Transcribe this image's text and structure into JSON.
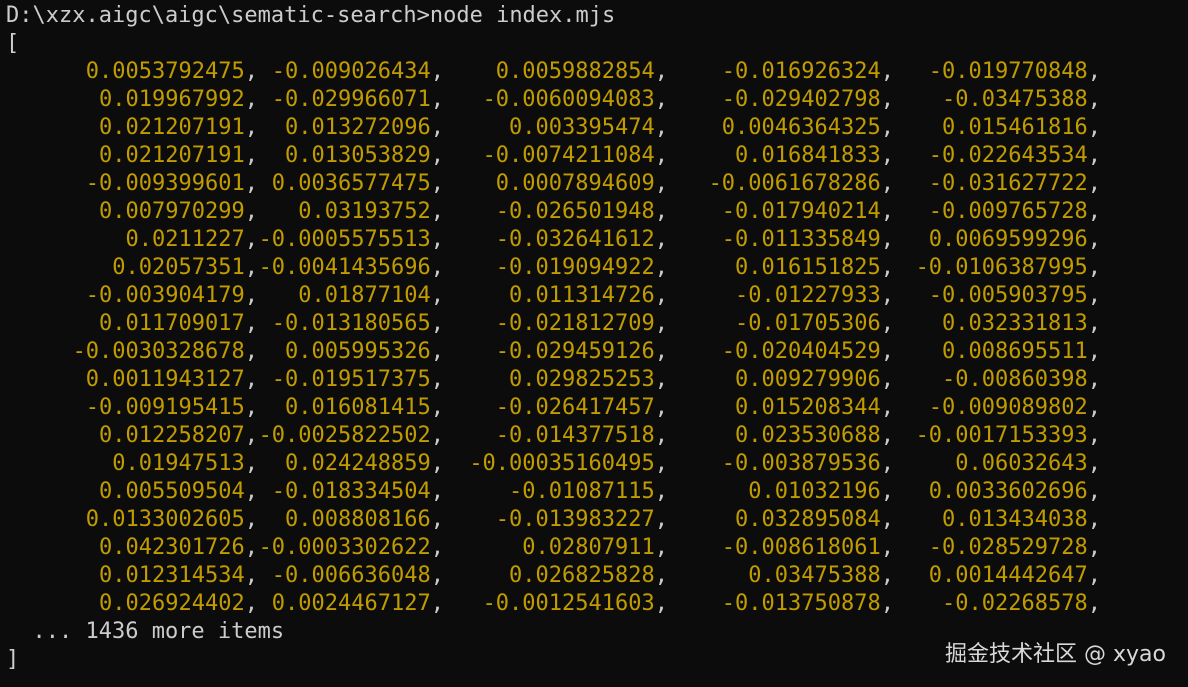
{
  "terminal": {
    "prompt_line": "D:\\xzx.aigc\\aigc\\sematic-search>node index.mjs",
    "open_bracket": "[",
    "rows": [
      [
        "0.0053792475",
        "-0.009026434",
        "0.0059882854",
        "-0.016926324",
        "-0.019770848"
      ],
      [
        "0.019967992",
        "-0.029966071",
        "-0.0060094083",
        "-0.029402798",
        "-0.03475388"
      ],
      [
        "0.021207191",
        "0.013272096",
        "0.003395474",
        "0.0046364325",
        "0.015461816"
      ],
      [
        "0.021207191",
        "0.013053829",
        "-0.0074211084",
        "0.016841833",
        "-0.022643534"
      ],
      [
        "-0.009399601",
        "0.0036577475",
        "0.0007894609",
        "-0.0061678286",
        "-0.031627722"
      ],
      [
        "0.007970299",
        "0.03193752",
        "-0.026501948",
        "-0.017940214",
        "-0.009765728"
      ],
      [
        "0.0211227",
        "-0.0005575513",
        "-0.032641612",
        "-0.011335849",
        "0.0069599296"
      ],
      [
        "0.02057351",
        "-0.0041435696",
        "-0.019094922",
        "0.016151825",
        "-0.0106387995"
      ],
      [
        "-0.003904179",
        "0.01877104",
        "0.011314726",
        "-0.01227933",
        "-0.005903795"
      ],
      [
        "0.011709017",
        "-0.013180565",
        "-0.021812709",
        "-0.01705306",
        "0.032331813"
      ],
      [
        "-0.0030328678",
        "0.005995326",
        "-0.029459126",
        "-0.020404529",
        "0.008695511"
      ],
      [
        "0.0011943127",
        "-0.019517375",
        "0.029825253",
        "0.009279906",
        "-0.00860398"
      ],
      [
        "-0.009195415",
        "0.016081415",
        "-0.026417457",
        "0.015208344",
        "-0.009089802"
      ],
      [
        "0.012258207",
        "-0.0025822502",
        "-0.014377518",
        "0.023530688",
        "-0.0017153393"
      ],
      [
        "0.01947513",
        "0.024248859",
        "-0.00035160495",
        "-0.003879536",
        "0.06032643"
      ],
      [
        "0.005509504",
        "-0.018334504",
        "-0.01087115",
        "0.01032196",
        "0.0033602696"
      ],
      [
        "0.0133002605",
        "0.008808166",
        "-0.013983227",
        "0.032895084",
        "0.013434038"
      ],
      [
        "0.042301726",
        "-0.0003302622",
        "0.02807911",
        "-0.008618061",
        "-0.028529728"
      ],
      [
        "0.012314534",
        "-0.006636048",
        "0.026825828",
        "0.03475388",
        "0.0014442647"
      ],
      [
        "0.026924402",
        "0.0024467127",
        "-0.0012541603",
        "-0.013750878",
        "-0.02268578"
      ]
    ],
    "more_items": "  ... 1436 more items",
    "close_bracket": "]"
  },
  "watermark": "掘金技术社区 @ xyao",
  "colors": {
    "background": "#0c0c0c",
    "text": "#cccccc",
    "number": "#c19c00"
  }
}
